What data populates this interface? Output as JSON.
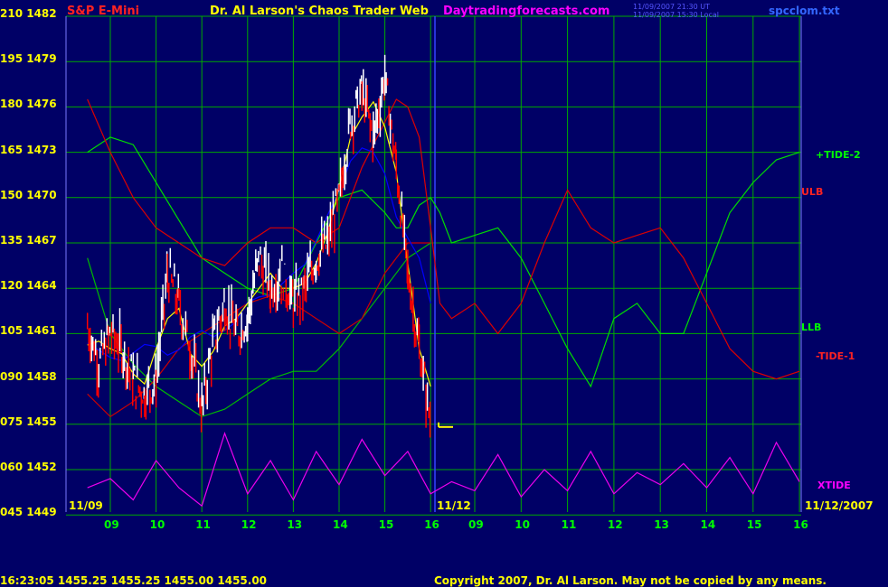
{
  "header": {
    "symbol": "S&P E-Mini",
    "title": "Dr. Al Larson's Chaos Trader Web",
    "website": "Daytradingforecasts.com",
    "stamp_line1": "11/09/2007 21:30 UT",
    "stamp_line2": "11/09/2007 15:30 Local",
    "file": "spcclom.txt"
  },
  "footer": {
    "quote": "16:23:05  1455.25  1455.25  1455.00  1455.00",
    "copyright": "Copyright 2007, Dr. Al Larson. May not be copied by any means."
  },
  "date_labels": {
    "left": "11/09",
    "middle": "11/12",
    "right": "11/12/2007"
  },
  "line_labels": {
    "tide2": "+TIDE-2",
    "ulb": "ULB",
    "llb": "LLB",
    "tide1": "-TIDE-1",
    "xtide": "XTIDE"
  },
  "colors": {
    "background": "#000066",
    "grid": "#00aa00",
    "axis_text": "#ffff00",
    "price_up": "#ffffff",
    "price_down": "#ff0000",
    "tide2_line": "#00dd00",
    "ulb_line": "#dd0000",
    "llb_line": "#00bb00",
    "tide1_line": "#cc0000",
    "xtide_line": "#ee00ee",
    "blue_line": "#0000ff",
    "yellow_line": "#ffff00",
    "hour_labels": "#00ff00"
  },
  "chart_data": {
    "type": "line",
    "title": "S&P E-Mini",
    "y_ticks": [
      {
        "osc": "210",
        "price": "1482"
      },
      {
        "osc": "195",
        "price": "1479"
      },
      {
        "osc": "180",
        "price": "1476"
      },
      {
        "osc": "165",
        "price": "1473"
      },
      {
        "osc": "150",
        "price": "1470"
      },
      {
        "osc": "135",
        "price": "1467"
      },
      {
        "osc": "120",
        "price": "1464"
      },
      {
        "osc": "105",
        "price": "1461"
      },
      {
        "osc": "090",
        "price": "1458"
      },
      {
        "osc": "075",
        "price": "1455"
      },
      {
        "osc": "060",
        "price": "1452"
      },
      {
        "osc": "045",
        "price": "1449"
      }
    ],
    "ylim_price": [
      1449,
      1482
    ],
    "ylim_osc": [
      45,
      210
    ],
    "x_hours_day1": [
      "09",
      "10",
      "11",
      "12",
      "13",
      "14",
      "15",
      "16"
    ],
    "x_hours_day2": [
      "09",
      "10",
      "11",
      "12",
      "13",
      "14",
      "15",
      "16"
    ],
    "grid": true,
    "price_trace": {
      "x": [
        8.5,
        8.75,
        9,
        9.25,
        9.5,
        9.75,
        10,
        10.25,
        10.5,
        10.75,
        11,
        11.25,
        11.5,
        11.75,
        12,
        12.25,
        12.5,
        12.75,
        13,
        13.25,
        13.5,
        13.75,
        14,
        14.25,
        14.5,
        14.75,
        15,
        15.25,
        15.5,
        15.75,
        16
      ],
      "y": [
        1461.5,
        1459,
        1461,
        1460,
        1458,
        1457,
        1458,
        1465,
        1463,
        1460,
        1456,
        1460.5,
        1463,
        1461,
        1462,
        1466,
        1464,
        1465,
        1463,
        1464,
        1466,
        1467,
        1470,
        1475,
        1477,
        1474,
        1478,
        1472,
        1465,
        1460,
        1455
      ]
    },
    "series": [
      {
        "name": "+TIDE-2",
        "x": [
          8.5,
          9,
          9.5,
          10,
          10.5,
          11,
          11.5,
          12,
          12.5,
          13,
          13.5,
          14,
          14.5,
          15,
          15.25,
          15.5,
          15.75,
          16,
          16.25,
          16.5,
          17,
          17.5,
          18,
          18.5,
          19,
          19.5,
          20,
          20.5,
          21,
          21.5,
          22,
          22.5,
          23,
          23.5,
          24
        ],
        "y": [
          1473,
          1474,
          1473.5,
          1471,
          1468.5,
          1466,
          1465,
          1464,
          1463.5,
          1464,
          1467,
          1470,
          1470.5,
          1469,
          1468,
          1468,
          1469.5,
          1470,
          1469,
          1467,
          1467.5,
          1468,
          1466,
          1463,
          1460,
          1457.5,
          1462,
          1463,
          1461,
          1461,
          1465,
          1469,
          1471,
          1472.5,
          1473
        ]
      },
      {
        "name": "ULB",
        "x": [
          8.5,
          9,
          9.5,
          10,
          10.5,
          11,
          11.5,
          12,
          12.5,
          13,
          13.5,
          14,
          14.5,
          15,
          15.25,
          15.5,
          15.75,
          16,
          16.25,
          16.5,
          17,
          17.5,
          18,
          18.5,
          19,
          19.5,
          20,
          20.5,
          21,
          21.5,
          22,
          22.5,
          23,
          23.5,
          24
        ],
        "y": [
          1476.5,
          1473,
          1470,
          1468,
          1467,
          1466,
          1465.5,
          1467,
          1468,
          1468,
          1467,
          1468,
          1472,
          1475,
          1476.5,
          1476,
          1474,
          1468,
          1463,
          1462,
          1463,
          1461,
          1463,
          1467,
          1470.5,
          1468,
          1467,
          1467.5,
          1468,
          1466,
          1463,
          1460,
          1458.5,
          1458,
          1458.5
        ]
      },
      {
        "name": "LLB",
        "x": [
          8.5,
          9,
          9.5,
          10,
          10.5,
          11,
          11.5,
          12,
          12.5,
          13,
          13.5,
          14,
          14.5,
          15,
          15.5,
          16
        ],
        "y": [
          1466,
          1461,
          1459,
          1457.5,
          1456.5,
          1455.5,
          1456,
          1457,
          1458,
          1458.5,
          1458.5,
          1460,
          1462,
          1464,
          1466,
          1467
        ]
      },
      {
        "name": "-TIDE-1",
        "x": [
          8.5,
          9,
          9.5,
          10,
          10.5,
          11,
          11.5,
          12,
          12.5,
          13,
          13.5,
          14,
          14.5,
          15,
          15.5,
          16
        ],
        "y": [
          1457,
          1455.5,
          1456.5,
          1458,
          1460,
          1461,
          1462,
          1463,
          1463.5,
          1463,
          1462,
          1461,
          1462,
          1465,
          1467,
          1467
        ]
      },
      {
        "name": "XTIDE",
        "x": [
          8.5,
          9,
          9.5,
          10,
          10.5,
          11,
          11.5,
          12,
          12.5,
          13,
          13.5,
          14,
          14.5,
          15,
          15.5,
          16,
          16.5,
          17,
          17.5,
          18,
          18.5,
          19,
          19.5,
          20,
          20.5,
          21,
          21.5,
          22,
          22.5,
          23,
          23.5,
          24
        ],
        "y": [
          54,
          57,
          50,
          63,
          54,
          48,
          72,
          52,
          63,
          50,
          66,
          55,
          70,
          58,
          66,
          52,
          56,
          53,
          65,
          51,
          60,
          53,
          66,
          52,
          59,
          55,
          62,
          54,
          64,
          52,
          69,
          56
        ]
      }
    ]
  }
}
